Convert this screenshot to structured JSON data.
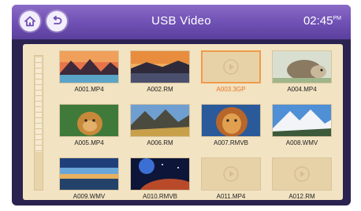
{
  "header": {
    "title": "USB Video",
    "time": "02:45",
    "time_suffix": "PM"
  },
  "videos": [
    {
      "name": "A001.MP4",
      "thumb": "sunset-mountains"
    },
    {
      "name": "A002.RM",
      "thumb": "dusk-lake"
    },
    {
      "name": "A003.3GP",
      "thumb": "placeholder",
      "selected": true
    },
    {
      "name": "A004.MP4",
      "thumb": "hedgehog"
    },
    {
      "name": "A005.MP4",
      "thumb": "lion-cub"
    },
    {
      "name": "A006.RM",
      "thumb": "mountain-valley"
    },
    {
      "name": "A007.RMVB",
      "thumb": "lion-face"
    },
    {
      "name": "A008.WMV",
      "thumb": "white-mountains"
    },
    {
      "name": "A009.WMV",
      "thumb": "horizon-water"
    },
    {
      "name": "A010.RMVB",
      "thumb": "space-planet"
    },
    {
      "name": "A011.MP4",
      "thumb": "placeholder"
    },
    {
      "name": "A012.RM",
      "thumb": "placeholder"
    }
  ],
  "colors": {
    "topbar": "#6e4fb3",
    "panel": "#f2e3c2",
    "selected": "#e8731e"
  }
}
